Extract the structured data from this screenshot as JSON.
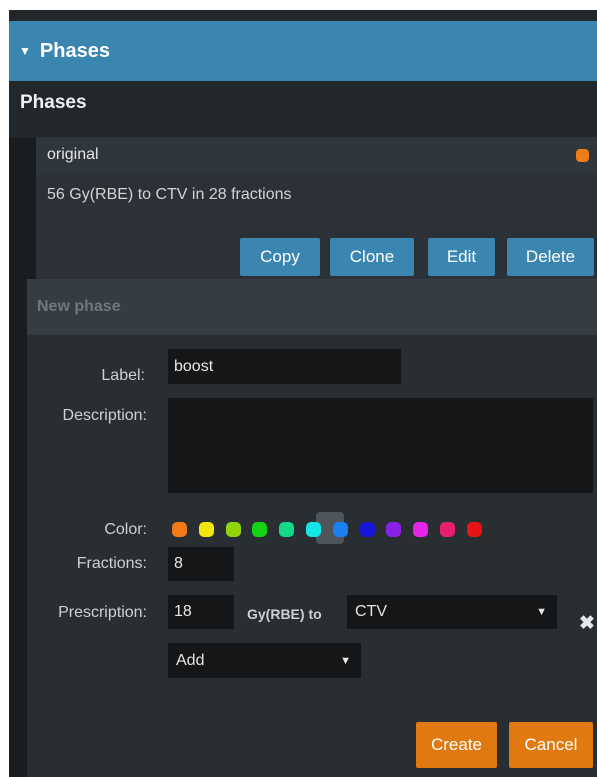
{
  "header": {
    "title": "Phases"
  },
  "section": {
    "title": "Phases"
  },
  "phase": {
    "label": "original",
    "color": "#f07c18",
    "description": "56 Gy(RBE) to CTV in 28 fractions",
    "buttons": {
      "copy": "Copy",
      "clone": "Clone",
      "edit": "Edit",
      "delete": "Delete"
    }
  },
  "new_phase": {
    "title": "New phase",
    "label_label": "Label:",
    "label_value": "boost",
    "description_label": "Description:",
    "description_value": "",
    "color_label": "Color:",
    "colors": [
      "#f07c18",
      "#f2e60c",
      "#8fd40c",
      "#13d313",
      "#12d98a",
      "#12e6e6",
      "#1a7ff0",
      "#1616d9",
      "#8a20e6",
      "#e626e6",
      "#e6206e",
      "#e61414"
    ],
    "selected_color_index": 5,
    "fractions_label": "Fractions:",
    "fractions_value": "8",
    "prescription_label": "Prescription:",
    "prescription_value": "18",
    "unit_text": "Gy(RBE) to",
    "target_selected": "CTV",
    "add_selected": "Add",
    "create_label": "Create",
    "cancel_label": "Cancel"
  }
}
